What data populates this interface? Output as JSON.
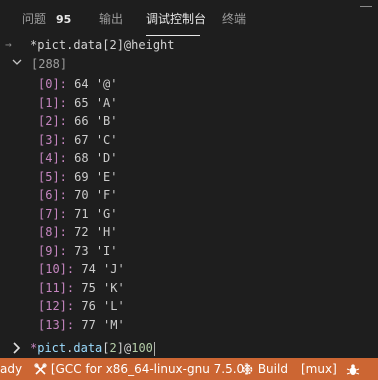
{
  "panel_tabs": [
    {
      "label": "问题",
      "badge": "95"
    },
    {
      "label": "输出"
    },
    {
      "label": "调试控制台",
      "active": true
    },
    {
      "label": "终端"
    }
  ],
  "console": {
    "expression": "*pict.data[2]@height",
    "array_summary": "[288]",
    "items": [
      {
        "index": "[0]:",
        "value": "64 '@'"
      },
      {
        "index": "[1]:",
        "value": "65 'A'"
      },
      {
        "index": "[2]:",
        "value": "66 'B'"
      },
      {
        "index": "[3]:",
        "value": "67 'C'"
      },
      {
        "index": "[4]:",
        "value": "68 'D'"
      },
      {
        "index": "[5]:",
        "value": "69 'E'"
      },
      {
        "index": "[6]:",
        "value": "70 'F'"
      },
      {
        "index": "[7]:",
        "value": "71 'G'"
      },
      {
        "index": "[8]:",
        "value": "72 'H'"
      },
      {
        "index": "[9]:",
        "value": "73 'I'"
      },
      {
        "index": "[10]:",
        "value": "74 'J'"
      },
      {
        "index": "[11]:",
        "value": "75 'K'"
      },
      {
        "index": "[12]:",
        "value": "76 'L'"
      },
      {
        "index": "[13]:",
        "value": "77 'M'"
      }
    ]
  },
  "input": {
    "star": "*",
    "ident1": "pict",
    "dot": ".",
    "ident2": "data",
    "bracket_open": "[",
    "num1": "2",
    "bracket_close": "]",
    "at": "@",
    "num2": "100"
  },
  "statusbar": {
    "ready": "ady",
    "kit": "[GCC for x86_64-linux-gnu 7.5.0]",
    "build": "Build",
    "target": "[mux]"
  },
  "colors": {
    "statusbar_bg": "#cc6633",
    "array_index": "#c586c0"
  }
}
